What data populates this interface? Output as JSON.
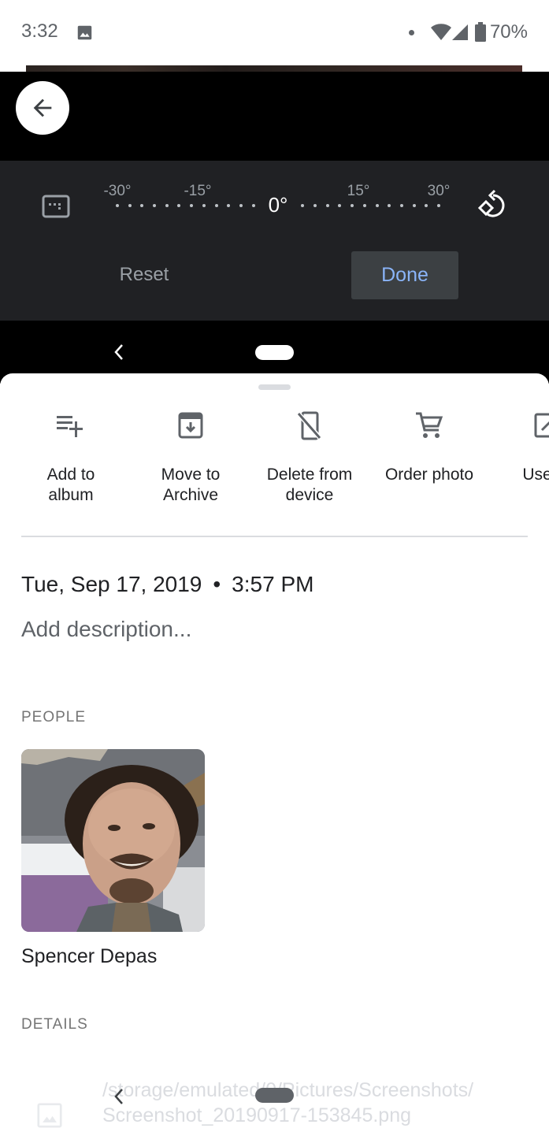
{
  "status_bar": {
    "time": "3:32",
    "notification_icon": "image-icon",
    "battery_percent": "70%",
    "icons": [
      "dot-icon",
      "wifi-icon",
      "cell-signal-icon",
      "battery-icon"
    ]
  },
  "editor": {
    "back_icon": "arrow-back-icon",
    "aspect_ratio_icon": "aspect-ratio-icon",
    "rotate_icon": "rotate-icon",
    "dial": {
      "current_value": "0°",
      "labels": [
        "-30°",
        "-15°",
        "15°",
        "30°"
      ],
      "current_angle_degrees": 0
    },
    "reset_label": "Reset",
    "done_label": "Done",
    "accent_color": "#8ab4f8"
  },
  "sheet": {
    "actions": [
      {
        "icon": "playlist-add-icon",
        "label": "Add to\nalbum"
      },
      {
        "icon": "archive-icon",
        "label": "Move to\nArchive"
      },
      {
        "icon": "phonelink-erase-icon",
        "label": "Delete from\ndevice"
      },
      {
        "icon": "shopping-cart-icon",
        "label": "Order photo"
      },
      {
        "icon": "open-in-icon",
        "label": "Use as"
      }
    ],
    "date": "Tue, Sep 17, 2019",
    "separator": "•",
    "time": "3:57 PM",
    "description_placeholder": "Add description...",
    "people_heading": "PEOPLE",
    "people": [
      {
        "name": "Spencer Depas"
      }
    ],
    "details_heading": "DETAILS",
    "file_path": "/storage/emulated/0/Pictures/Screenshots/\nScreenshot_20190917-153845.png"
  }
}
